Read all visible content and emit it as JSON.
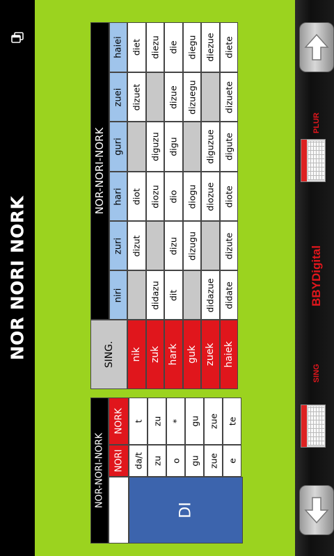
{
  "page": {
    "title": "NOR NORI NORK"
  },
  "small_table": {
    "header": "NOR-NORI-NORK",
    "col_labels": [
      "NORI",
      "NORK"
    ],
    "label": "DI",
    "nori": [
      "da/t",
      "zu",
      "o",
      "gu",
      "zue",
      "e"
    ],
    "nork": [
      "t",
      "zu",
      "*",
      "gu",
      "zue",
      "te"
    ]
  },
  "big_table": {
    "corner": "SING.",
    "header": "NOR-NORI-NORK",
    "columns": [
      "niri",
      "zuri",
      "hari",
      "guri",
      "zuei",
      "haiei"
    ],
    "rows": [
      {
        "label": "nik",
        "cells": [
          "",
          "dizut",
          "diot",
          "",
          "dizuet",
          "diet"
        ]
      },
      {
        "label": "zuk",
        "cells": [
          "didazu",
          "",
          "diozu",
          "diguzu",
          "",
          "diezu"
        ]
      },
      {
        "label": "hark",
        "cells": [
          "dit",
          "dizu",
          "dio",
          "digu",
          "dizue",
          "die"
        ]
      },
      {
        "label": "guk",
        "cells": [
          "",
          "dizugu",
          "diogu",
          "",
          "dizuegu",
          "diegu"
        ]
      },
      {
        "label": "zuek",
        "cells": [
          "didazue",
          "",
          "diozue",
          "diguzue",
          "",
          "diezue"
        ]
      },
      {
        "label": "haiek",
        "cells": [
          "didate",
          "dizute",
          "diote",
          "digute",
          "dizuete",
          "diete"
        ]
      }
    ]
  },
  "nav": {
    "sing_label": "SING",
    "plur_label": "PLUR",
    "brand": "BBYDigital"
  },
  "colors": {
    "green": "#9bd31f",
    "red": "#e0161c",
    "blue": "#3c64ad",
    "light_blue": "#9fc4eb",
    "gray": "#c8c8c8"
  },
  "icons": {
    "copy": "copy-icon",
    "up": "arrow-up-icon",
    "down": "arrow-down-icon"
  }
}
